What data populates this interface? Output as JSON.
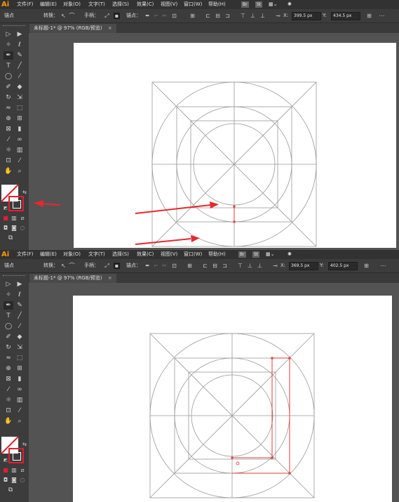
{
  "app": {
    "logo": "Ai"
  },
  "menu": {
    "items": [
      "文件(F)",
      "编辑(E)",
      "对象(O)",
      "文字(T)",
      "选择(S)",
      "效果(C)",
      "视图(V)",
      "窗口(W)",
      "帮助(H)"
    ],
    "badges": [
      "Br",
      "St"
    ]
  },
  "options_bar": {
    "anchor_label": "锚点",
    "convert_label": "转换：",
    "handle_label": "手柄：",
    "anchor_label2": "锚点：",
    "screens": [
      {
        "x_label": "X:",
        "x_value": "399.5 px",
        "y_label": "Y:",
        "y_value": "434.5 px"
      },
      {
        "x_label": "X:",
        "x_value": "369.5 px",
        "y_label": "Y:",
        "y_value": "402.5 px"
      }
    ]
  },
  "document": {
    "tab_labels": [
      "未标题-1* @ 97% (RGB/预览)",
      "未标题-1* @ 97% (RGB/预览)"
    ],
    "tab_close": "×"
  },
  "toolbar": {
    "tools": [
      "selection-tool",
      "direct-selection-tool",
      "magic-wand-tool",
      "lasso-tool",
      "pen-tool",
      "curvature-tool",
      "type-tool",
      "line-segment-tool",
      "ellipse-tool",
      "paintbrush-tool",
      "shaper-tool",
      "eraser-tool",
      "rotate-tool",
      "scale-tool",
      "width-tool",
      "free-transform-tool",
      "shape-builder-tool",
      "perspective-grid-tool",
      "mesh-tool",
      "gradient-tool",
      "eyedropper-tool",
      "blend-tool",
      "symbol-sprayer-tool",
      "column-graph-tool",
      "artboard-tool",
      "slice-tool",
      "hand-tool",
      "zoom-tool"
    ]
  },
  "colors": {
    "accent": "#e21e2e",
    "annotation_arrow": "#e8282e",
    "guide_line": "#999999",
    "path_red": "#e33a3a"
  }
}
